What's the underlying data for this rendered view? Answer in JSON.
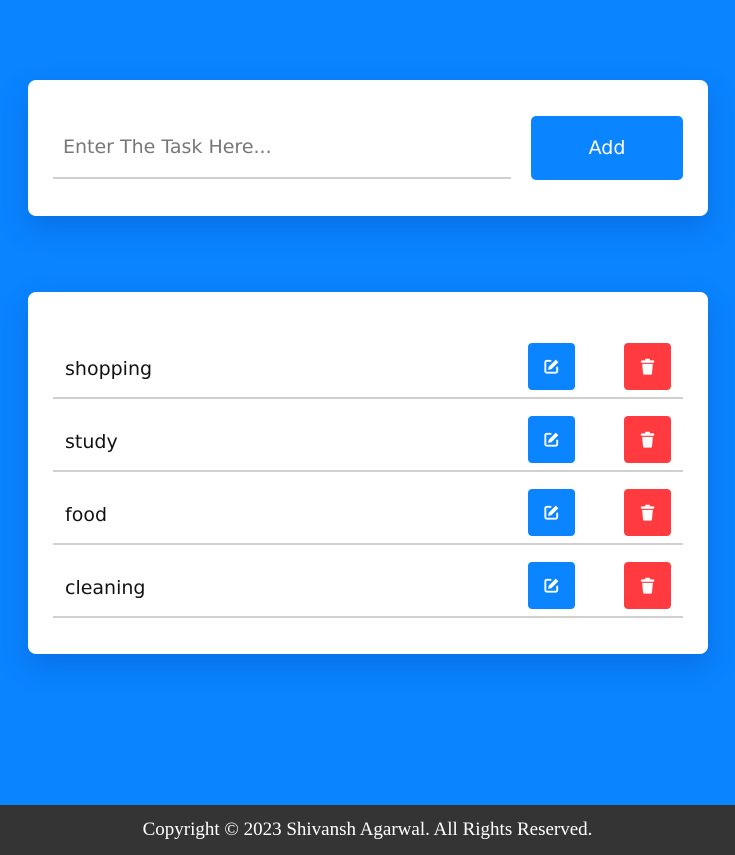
{
  "colors": {
    "background": "#0a84ff",
    "accent": "#0a84ff",
    "danger": "#ff3b3f",
    "footer": "#343434"
  },
  "input_panel": {
    "task_input_placeholder": "Enter The Task Here...",
    "task_input_value": "",
    "add_label": "Add"
  },
  "tasks": [
    {
      "label": "shopping",
      "edit_icon": "edit-icon",
      "delete_icon": "trash-icon"
    },
    {
      "label": "study",
      "edit_icon": "edit-icon",
      "delete_icon": "trash-icon"
    },
    {
      "label": "food",
      "edit_icon": "edit-icon",
      "delete_icon": "trash-icon"
    },
    {
      "label": "cleaning",
      "edit_icon": "edit-icon",
      "delete_icon": "trash-icon"
    }
  ],
  "footer": {
    "text": "Copyright © 2023 Shivansh Agarwal. All Rights Reserved."
  }
}
